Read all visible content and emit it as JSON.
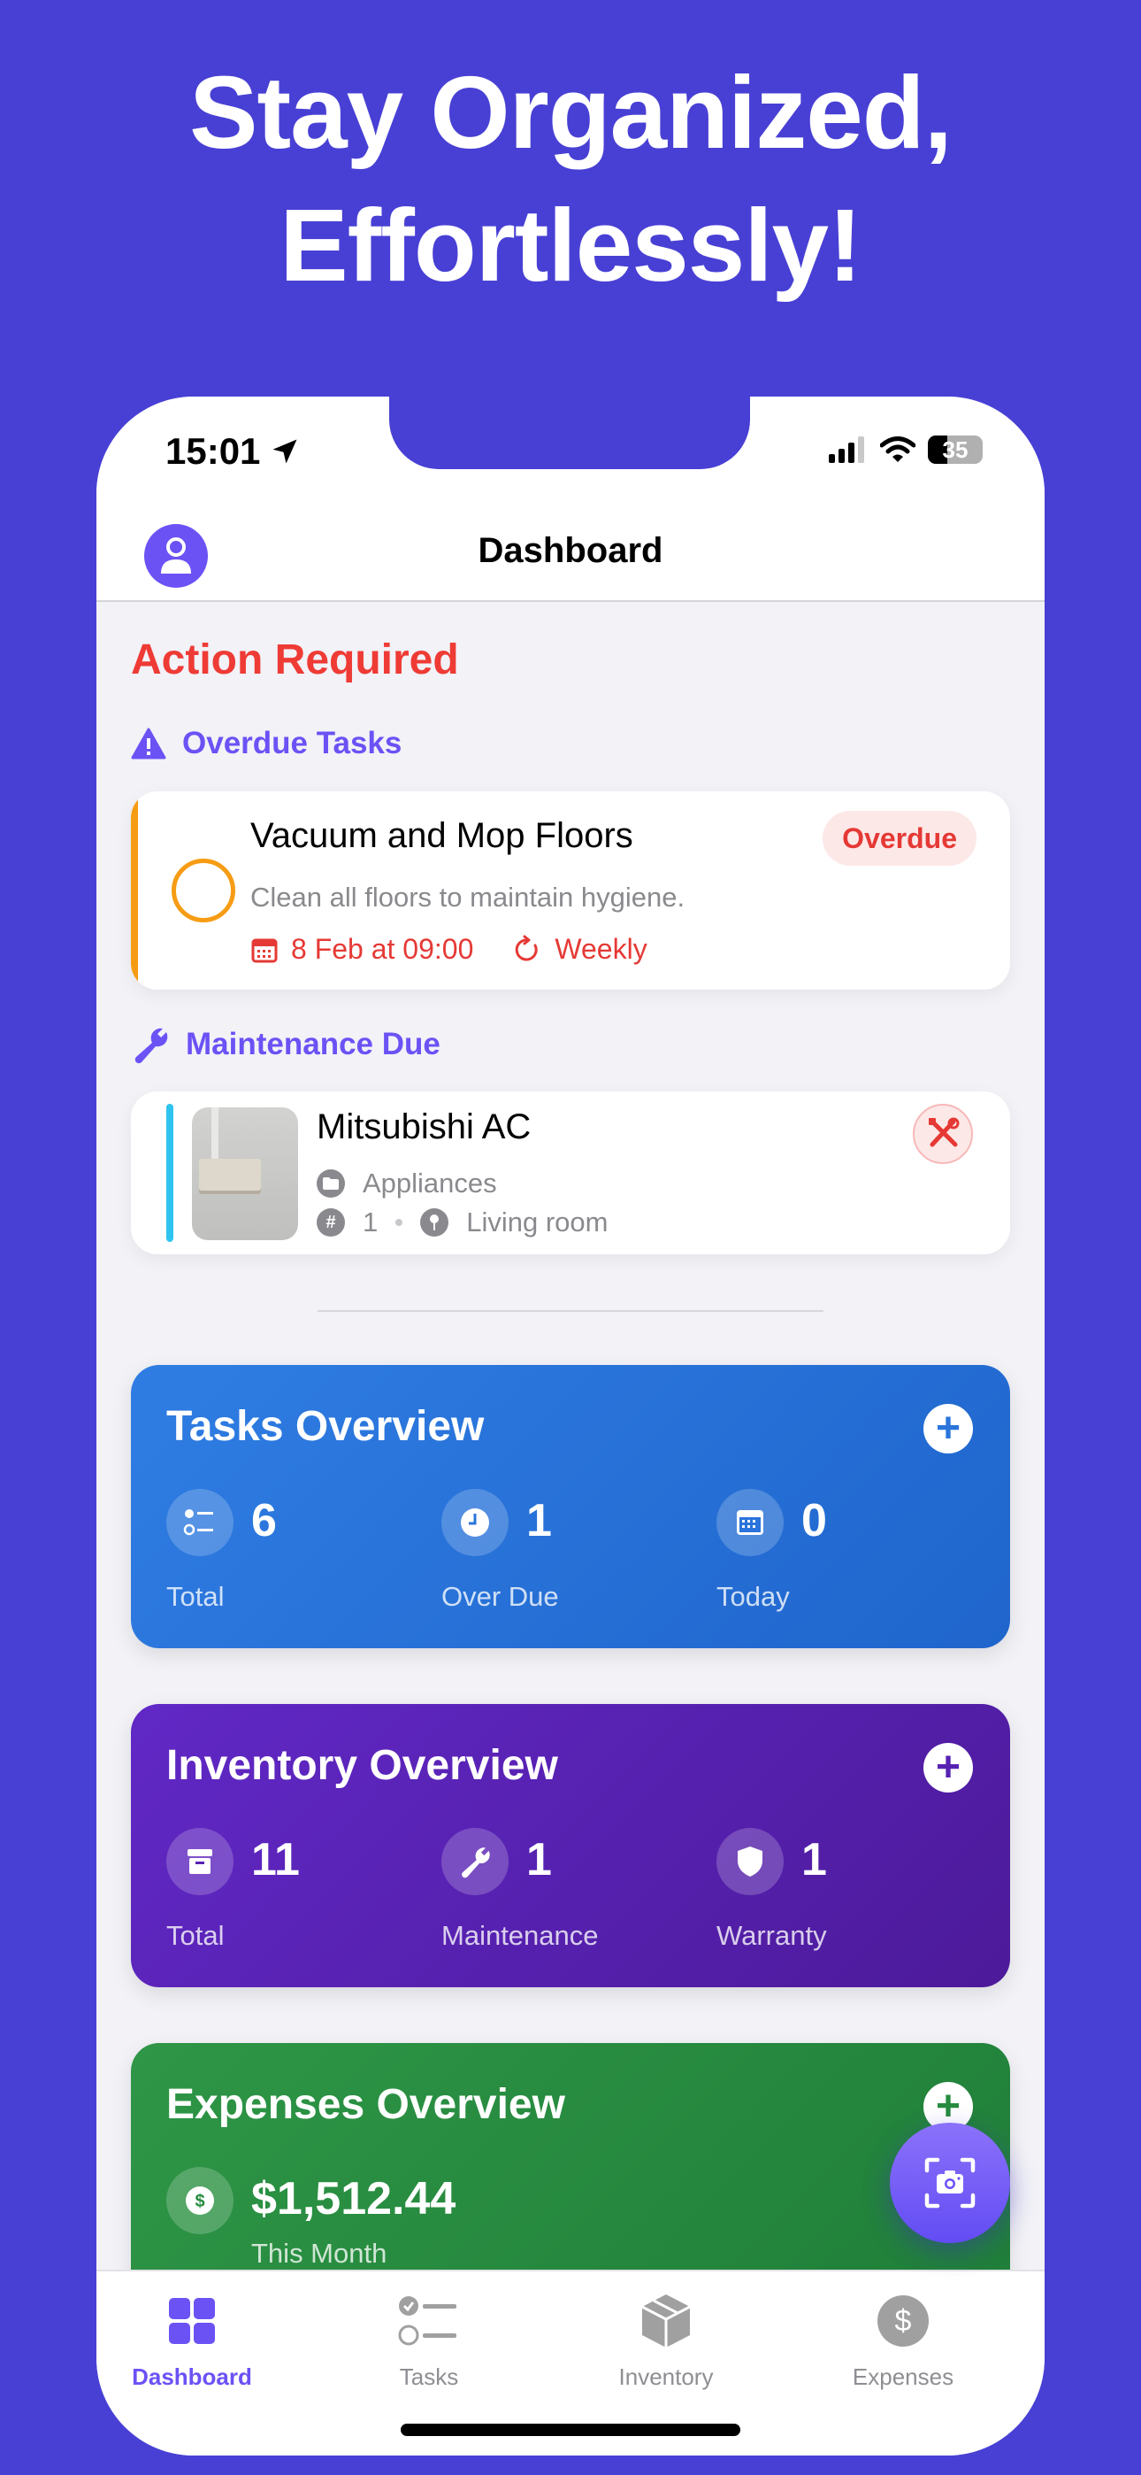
{
  "promo": {
    "headline_line1": "Stay Organized,",
    "headline_line2": "Effortlessly!",
    "background_color": "#4840d4"
  },
  "status_bar": {
    "time": "15:01",
    "battery_percent": "35"
  },
  "nav": {
    "title": "Dashboard"
  },
  "action_required": {
    "title": "Action Required",
    "overdue_section": {
      "title": "Overdue Tasks",
      "task": {
        "title": "Vacuum and Mop Floors",
        "description": "Clean all floors to maintain hygiene.",
        "due": "8 Feb at 09:00",
        "recurrence": "Weekly",
        "badge": "Overdue"
      }
    },
    "maintenance_section": {
      "title": "Maintenance Due",
      "item": {
        "name": "Mitsubishi AC",
        "category": "Appliances",
        "quantity": "1",
        "location": "Living room"
      }
    }
  },
  "tasks_overview": {
    "title": "Tasks Overview",
    "add_label": "+",
    "stats": [
      {
        "value": "6",
        "label": "Total",
        "icon": "checklist-icon"
      },
      {
        "value": "1",
        "label": "Over Due",
        "icon": "clock-icon"
      },
      {
        "value": "0",
        "label": "Today",
        "icon": "calendar-icon"
      }
    ]
  },
  "inventory_overview": {
    "title": "Inventory Overview",
    "add_label": "+",
    "stats": [
      {
        "value": "11",
        "label": "Total",
        "icon": "archive-box-icon"
      },
      {
        "value": "1",
        "label": "Maintenance",
        "icon": "wrench-icon"
      },
      {
        "value": "1",
        "label": "Warranty",
        "icon": "shield-icon"
      }
    ]
  },
  "expenses_overview": {
    "title": "Expenses Overview",
    "add_label": "+",
    "amount": "$1,512.44",
    "period": "This Month"
  },
  "tab_bar": {
    "tabs": [
      {
        "label": "Dashboard",
        "active": true
      },
      {
        "label": "Tasks",
        "active": false
      },
      {
        "label": "Inventory",
        "active": false
      },
      {
        "label": "Expenses",
        "active": false
      }
    ]
  },
  "colors": {
    "accent": "#6b52f5",
    "danger": "#e53935",
    "overdue_accent": "#f69c14",
    "maintenance_accent": "#2ec4f0",
    "tasks_card": "#2a74dc",
    "inventory_card": "#5722b2",
    "expenses_card": "#288c40"
  }
}
